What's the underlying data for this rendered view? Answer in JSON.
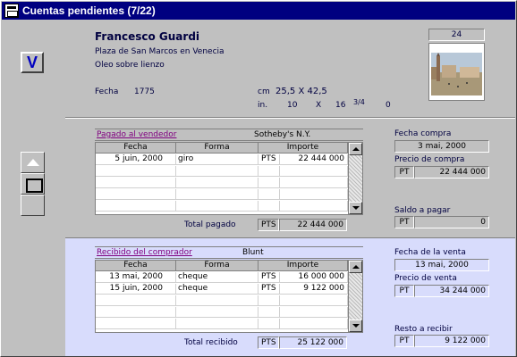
{
  "window": {
    "title": "Cuentas pendientes (7/22)"
  },
  "leftbar": {
    "v_label": "V"
  },
  "artwork": {
    "artist": "Francesco Guardi",
    "title": "Plaza de San Marcos en Venecia",
    "medium": "Oleo sobre lienzo",
    "fecha_label": "Fecha",
    "fecha_value": "1775",
    "cm_label": "cm",
    "cm_value": "25,5 X 42,5",
    "in_label": "in.",
    "in_a": "10",
    "in_x": "X",
    "in_b": "16",
    "in_frac": "3/4",
    "in_c": "0",
    "item_number": "24"
  },
  "purchase": {
    "link_label": "Pagado al vendedor",
    "party": "Sotheby's N.Y.",
    "headers": [
      "Fecha",
      "Forma",
      "Importe"
    ],
    "rows": [
      {
        "fecha": "5 juin, 2000",
        "forma": "giro",
        "cur": "PTS",
        "amount": "22 444 000"
      }
    ],
    "total_label": "Total pagado",
    "total_cur": "PTS",
    "total_amount": "22 444 000",
    "fecha_compra_label": "Fecha compra",
    "fecha_compra": "3 mai, 2000",
    "precio_label": "Precio de compra",
    "precio_cur": "PT",
    "precio": "22 444 000",
    "saldo_label": "Saldo a pagar",
    "saldo_cur": "PT",
    "saldo": "0"
  },
  "sale": {
    "link_label": "Recibido del comprador",
    "party": "Blunt",
    "headers": [
      "Fecha",
      "Forma",
      "Importe"
    ],
    "rows": [
      {
        "fecha": "13 mai, 2000",
        "forma": "cheque",
        "cur": "PTS",
        "amount": "16 000 000"
      },
      {
        "fecha": "15 juin, 2000",
        "forma": "cheque",
        "cur": "PTS",
        "amount": "9 122 000"
      }
    ],
    "total_label": "Total recibido",
    "total_cur": "PTS",
    "total_amount": "25 122 000",
    "fecha_venta_label": "Fecha de la venta",
    "fecha_venta": "13 mai, 2000",
    "precio_label": "Precio de venta",
    "precio_cur": "PT",
    "precio": "34 244 000",
    "resto_label": "Resto a recibir",
    "resto_cur": "PT",
    "resto": "9 122 000"
  }
}
